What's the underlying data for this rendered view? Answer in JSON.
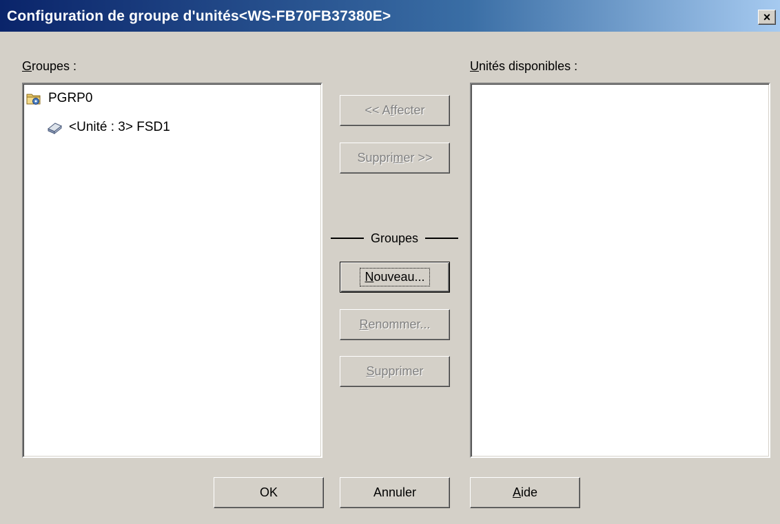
{
  "window": {
    "title": "Configuration de groupe d'unités<WS-FB70FB37380E>",
    "close_label": "×"
  },
  "groups_panel": {
    "label_accel": "G",
    "label_rest": "roupes :",
    "tree": [
      {
        "label": "PGRP0",
        "icon": "folder-group-icon",
        "level": 0
      },
      {
        "label": "<Unité : 3> FSD1",
        "icon": "disk-drive-icon",
        "level": 1
      }
    ]
  },
  "available_panel": {
    "label_accel": "U",
    "label_rest": "nités disponibles :"
  },
  "middle": {
    "assign_pre": "<< A",
    "assign_accel": "f",
    "assign_post": "fecter",
    "remove_pre": "Suppri",
    "remove_accel": "m",
    "remove_post": "er >>",
    "groups_title": "Groupes",
    "new_accel": "N",
    "new_rest": "ouveau...",
    "rename_accel": "R",
    "rename_rest": "enommer...",
    "delete_accel": "S",
    "delete_rest": "upprimer"
  },
  "footer": {
    "ok_label": "OK",
    "cancel_label": "Annuler",
    "help_accel": "A",
    "help_rest": "ide"
  }
}
